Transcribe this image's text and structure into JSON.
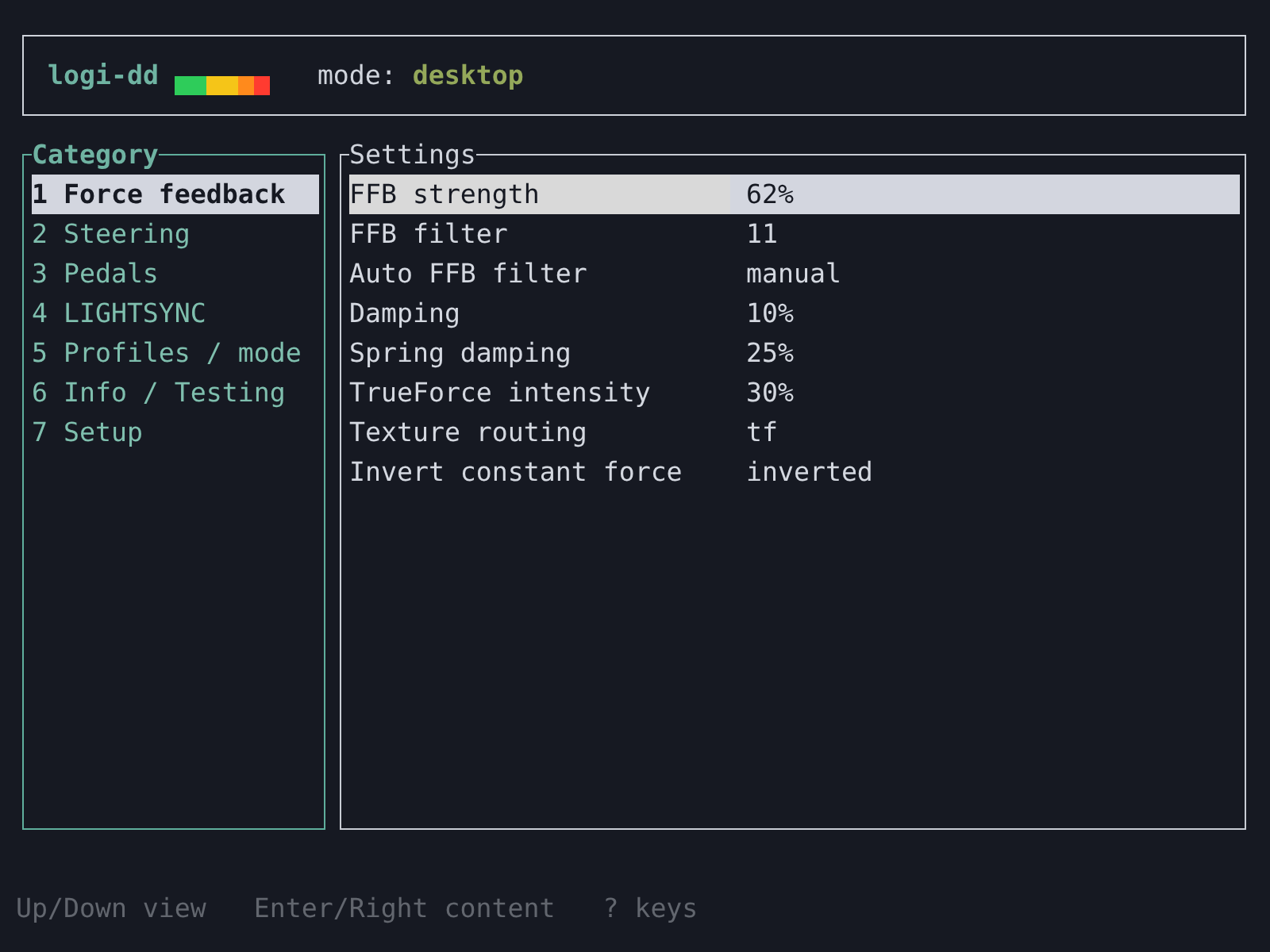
{
  "header": {
    "app_name": "logi-dd",
    "led_segments": [
      {
        "color": "#2ecc5a"
      },
      {
        "color": "#2ecc5a"
      },
      {
        "color": "#f5c518"
      },
      {
        "color": "#f5c518"
      },
      {
        "color": "#ff8a1c"
      },
      {
        "color": "#ff3b30"
      }
    ],
    "mode_label": "mode:",
    "mode_value": "desktop"
  },
  "category_panel": {
    "title": "Category",
    "items": [
      {
        "label": "1 Force feedback",
        "selected": true
      },
      {
        "label": "2 Steering",
        "selected": false
      },
      {
        "label": "3 Pedals",
        "selected": false
      },
      {
        "label": "4 LIGHTSYNC",
        "selected": false
      },
      {
        "label": "5 Profiles / mode",
        "selected": false
      },
      {
        "label": "6 Info / Testing",
        "selected": false
      },
      {
        "label": "7 Setup",
        "selected": false
      }
    ]
  },
  "settings_panel": {
    "title": "Settings",
    "rows": [
      {
        "label": "FFB strength",
        "value": "62%",
        "selected": true
      },
      {
        "label": "FFB filter",
        "value": "11",
        "selected": false
      },
      {
        "label": "Auto FFB filter",
        "value": "manual",
        "selected": false
      },
      {
        "label": "Damping",
        "value": "10%",
        "selected": false
      },
      {
        "label": "Spring damping",
        "value": "25%",
        "selected": false
      },
      {
        "label": "TrueForce intensity",
        "value": "30%",
        "selected": false
      },
      {
        "label": "Texture routing",
        "value": "tf",
        "selected": false
      },
      {
        "label": "Invert constant force",
        "value": "inverted",
        "selected": false
      }
    ]
  },
  "footer": {
    "hints": [
      "Up/Down view",
      "Enter/Right content",
      "? keys"
    ]
  }
}
